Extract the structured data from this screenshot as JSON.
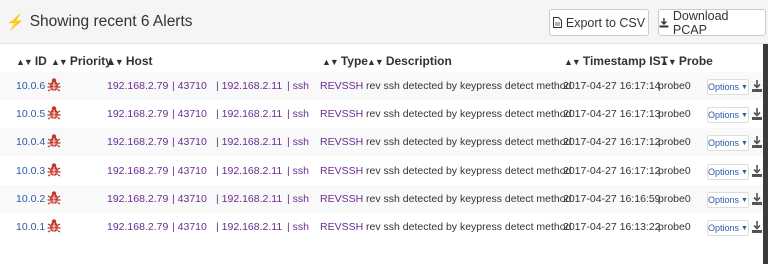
{
  "header": {
    "title": "Showing recent 6 Alerts",
    "export_csv_label": "Export to CSV",
    "download_pcap_label": "Download PCAP"
  },
  "columns": {
    "id": "ID",
    "priority": "Priority",
    "host": "Host",
    "type": "Type",
    "description": "Description",
    "timestamp": "Timestamp IST",
    "probe": "Probe"
  },
  "rows": [
    {
      "id": "10.0.6",
      "src": "192.168.2.79",
      "port": "| 43710",
      "dst": "| 192.168.2.11",
      "proto": "| ssh",
      "type": "REVSSH",
      "description": "rev ssh detected by keypress detect method",
      "timestamp": "2017-04-27 16:17:14",
      "probe": "probe0",
      "options": "Options"
    },
    {
      "id": "10.0.5",
      "src": "192.168.2.79",
      "port": "| 43710",
      "dst": "| 192.168.2.11",
      "proto": "| ssh",
      "type": "REVSSH",
      "description": "rev ssh detected by keypress detect method",
      "timestamp": "2017-04-27 16:17:13",
      "probe": "probe0",
      "options": "Options"
    },
    {
      "id": "10.0.4",
      "src": "192.168.2.79",
      "port": "| 43710",
      "dst": "| 192.168.2.11",
      "proto": "| ssh",
      "type": "REVSSH",
      "description": "rev ssh detected by keypress detect method",
      "timestamp": "2017-04-27 16:17:12",
      "probe": "probe0",
      "options": "Options"
    },
    {
      "id": "10.0.3",
      "src": "192.168.2.79",
      "port": "| 43710",
      "dst": "| 192.168.2.11",
      "proto": "| ssh",
      "type": "REVSSH",
      "description": "rev ssh detected by keypress detect method",
      "timestamp": "2017-04-27 16:17:12",
      "probe": "probe0",
      "options": "Options"
    },
    {
      "id": "10.0.2",
      "src": "192.168.2.79",
      "port": "| 43710",
      "dst": "| 192.168.2.11",
      "proto": "| ssh",
      "type": "REVSSH",
      "description": "rev ssh detected by keypress detect method",
      "timestamp": "2017-04-27 16:16:59",
      "probe": "probe0",
      "options": "Options"
    },
    {
      "id": "10.0.1",
      "src": "192.168.2.79",
      "port": "| 43710",
      "dst": "| 192.168.2.11",
      "proto": "| ssh",
      "type": "REVSSH",
      "description": "rev ssh detected by keypress detect method",
      "timestamp": "2017-04-27 16:13:22",
      "probe": "probe0",
      "options": "Options"
    }
  ],
  "icons": {
    "title_icon": "lightning-bolt-icon",
    "export_icon": "file-csv-icon",
    "pcap_icon": "download-icon",
    "priority_icon": "bug-icon",
    "row_download_icon": "download-icon"
  },
  "colors": {
    "priority_bug": "#c0392b",
    "link": "#6a2c91",
    "id_link": "#2a5aa8"
  }
}
